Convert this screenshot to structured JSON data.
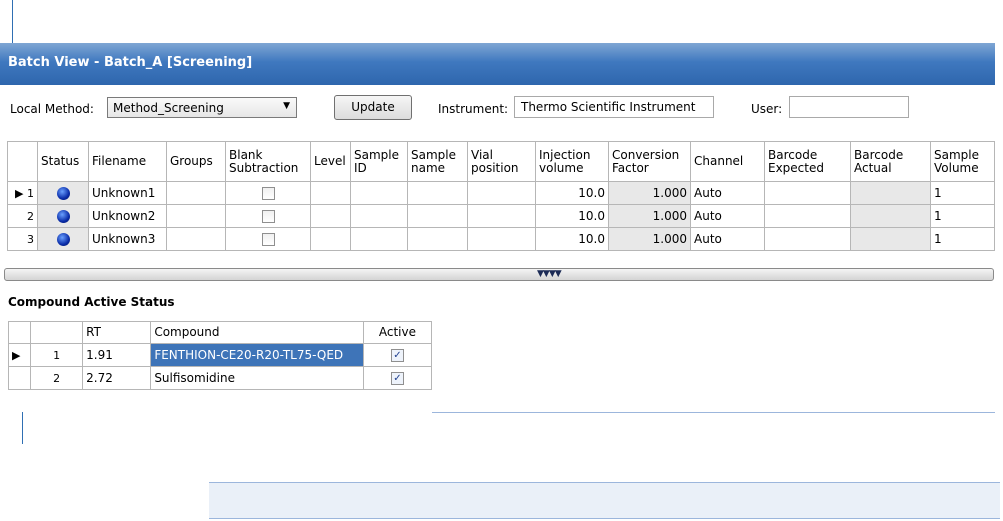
{
  "window": {
    "title": "Batch View - Batch_A  [Screening]"
  },
  "toolbar": {
    "local_method_label": "Local Method:",
    "local_method_value": "Method_Screening",
    "update_label": "Update",
    "instrument_label": "Instrument:",
    "instrument_value": "Thermo Scientific Instrument",
    "user_label": "User:",
    "user_value": ""
  },
  "samples": {
    "columns": [
      "Status",
      "Filename",
      "Groups",
      "Blank\nSubtraction",
      "Level",
      "Sample\nID",
      "Sample\nname",
      "Vial\nposition",
      "Injection\nvolume",
      "Conversion\nFactor",
      "Channel",
      "Barcode\nExpected",
      "Barcode\nActual",
      "Sample\nVolume"
    ],
    "rows": [
      {
        "num": "1",
        "filename": "Unknown1",
        "injection": "10.0",
        "conversion": "1.000",
        "channel": "Auto",
        "sample_volume": "1"
      },
      {
        "num": "2",
        "filename": "Unknown2",
        "injection": "10.0",
        "conversion": "1.000",
        "channel": "Auto",
        "sample_volume": "1"
      },
      {
        "num": "3",
        "filename": "Unknown3",
        "injection": "10.0",
        "conversion": "1.000",
        "channel": "Auto",
        "sample_volume": "1"
      }
    ]
  },
  "splitter": {
    "glyph": "▼▼▼▼"
  },
  "compounds": {
    "title": "Compound Active Status",
    "columns": [
      "RT",
      "Compound",
      "Active"
    ],
    "rows": [
      {
        "num": "1",
        "rt": "1.91",
        "compound": "FENTHION-CE20-R20-TL75-QED",
        "active": true
      },
      {
        "num": "2",
        "rt": "2.72",
        "compound": "Sulfisomidine",
        "active": true
      }
    ]
  },
  "colors": {
    "title_bar": "#2e66ad",
    "callout": "#2f6fb3"
  }
}
